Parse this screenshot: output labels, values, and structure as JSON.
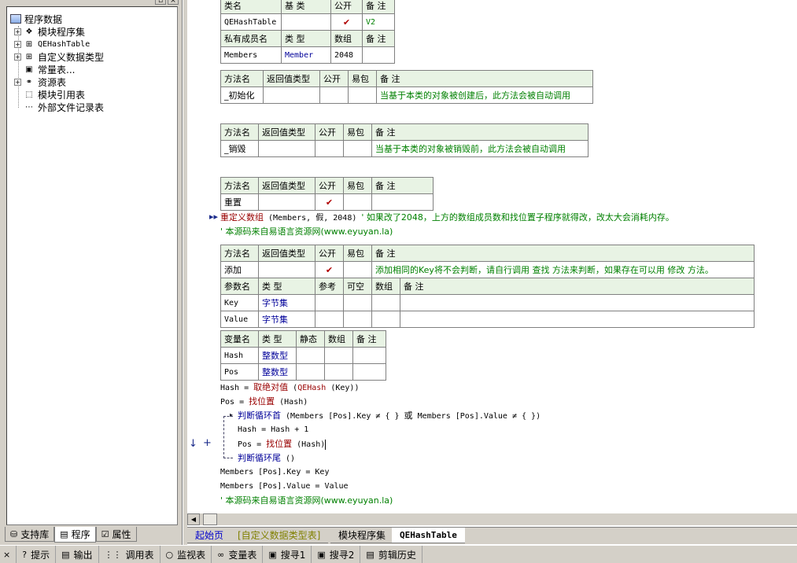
{
  "sidebar": {
    "root": "程序数据",
    "items": [
      {
        "label": "模块程序集",
        "icon": "module-icon",
        "has_expander": true
      },
      {
        "label": "QEHashTable",
        "icon": "class-icon",
        "has_expander": true
      },
      {
        "label": "自定义数据类型",
        "icon": "datatype-icon",
        "has_expander": true
      },
      {
        "label": "常量表...",
        "icon": "constant-icon",
        "has_expander": false
      },
      {
        "label": "资源表",
        "icon": "resource-icon",
        "has_expander": true
      },
      {
        "label": "模块引用表",
        "icon": "reference-icon",
        "has_expander": false
      },
      {
        "label": "外部文件记录表",
        "icon": "file-icon",
        "has_expander": false
      }
    ],
    "tabs": [
      {
        "label": "支持库",
        "icon": "library-icon"
      },
      {
        "label": "程序",
        "icon": "program-icon"
      },
      {
        "label": "属性",
        "icon": "property-icon"
      }
    ]
  },
  "class_table": {
    "headers": [
      "类名",
      "基 类",
      "公开",
      "备 注"
    ],
    "row": {
      "name": "QEHashTable",
      "base": "",
      "public": "✔",
      "note": "V2"
    },
    "member_headers": [
      "私有成员名",
      "类 型",
      "数组",
      "备 注"
    ],
    "member": {
      "name": "Members",
      "type": "Member",
      "array": "2048",
      "note": ""
    }
  },
  "method_headers": [
    "方法名",
    "返回值类型",
    "公开",
    "易包",
    "备 注"
  ],
  "methods": {
    "init": {
      "name": "_初始化",
      "note": "当基于本类的对象被创建后，此方法会被自动调用"
    },
    "destroy": {
      "name": "_销毁",
      "note": "当基于本类的对象被销毁前，此方法会被自动调用"
    },
    "reset": {
      "name": "重置",
      "public": "✔"
    },
    "add": {
      "name": "添加",
      "public": "✔",
      "note": "添加相同的Key将不会判断，请自行调用 查找 方法来判断，如果存在可以用 修改 方法。"
    }
  },
  "reset_code": {
    "kw": "重定义数组",
    "args": " (Members, 假, 2048) ",
    "comment": "' 如果改了2048，上方的数组成员数和找位置子程序就得改，改太大会消耗内存。",
    "source": "' 本源码来自易语言资源网(www.eyuyan.la)"
  },
  "param_headers": [
    "参数名",
    "类 型",
    "参考",
    "可空",
    "数组",
    "备 注"
  ],
  "params": [
    {
      "name": "Key",
      "type": "字节集"
    },
    {
      "name": "Value",
      "type": "字节集"
    }
  ],
  "var_headers": [
    "变量名",
    "类 型",
    "静态",
    "数组",
    "备 注"
  ],
  "vars": [
    {
      "name": "Hash",
      "type": "整数型"
    },
    {
      "name": "Pos",
      "type": "整数型"
    }
  ],
  "code": {
    "l1_a": "Hash = ",
    "l1_kw": "取绝对值",
    "l1_b": " (",
    "l1_c": "QEHash",
    "l1_d": " (Key))",
    "l2_a": "Pos = ",
    "l2_kw": "找位置",
    "l2_b": " (Hash)",
    "l3_kw": "判断循环首",
    "l3_b": " (Members [Pos].Key ≠ {  } ",
    "l3_or": "或",
    "l3_c": " Members [Pos].Value ≠ {  })",
    "l4": "Hash = Hash + 1",
    "l5_a": "Pos = ",
    "l5_kw": "找位置",
    "l5_b": " (Hash)",
    "l6_kw": "判断循环尾",
    "l6_b": " ()",
    "l7": "Members [Pos].Key = Key",
    "l8": "Members [Pos].Value = Value",
    "l9": "' 本源码来自易语言资源网(www.eyuyan.la)"
  },
  "doc_tabs": [
    "起始页",
    "[自定义数据类型表]",
    "模块程序集",
    "QEHashTable"
  ],
  "bottom_bar": [
    {
      "label": "提示",
      "icon": "tip-icon"
    },
    {
      "label": "输出",
      "icon": "output-icon"
    },
    {
      "label": "调用表",
      "icon": "callstack-icon"
    },
    {
      "label": "监视表",
      "icon": "watch-icon"
    },
    {
      "label": "变量表",
      "icon": "variable-icon"
    },
    {
      "label": "搜寻1",
      "icon": "search1-icon"
    },
    {
      "label": "搜寻2",
      "icon": "search2-icon"
    },
    {
      "label": "剪辑历史",
      "icon": "clipboard-icon"
    }
  ],
  "colors": {
    "header_bg": "#e8f3e4",
    "comment": "#008000",
    "keyword": "#990000",
    "type": "#000099"
  }
}
